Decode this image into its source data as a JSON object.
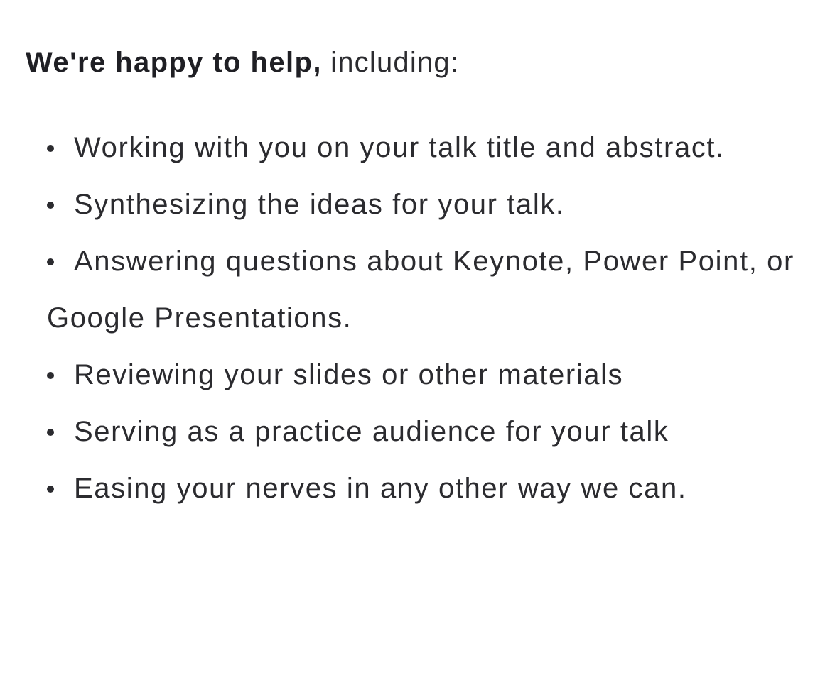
{
  "intro": {
    "lead": "We're happy to help,",
    "rest": " including:"
  },
  "help_items": [
    "Working with you on your talk title and abstract.",
    "Synthesizing the ideas for your talk.",
    "Answering questions about Keynote, Power Point, or Google Presentations.",
    "Reviewing your slides or other materials",
    "Serving as a practice audience for your talk",
    "Easing your nerves in any other way we can."
  ]
}
